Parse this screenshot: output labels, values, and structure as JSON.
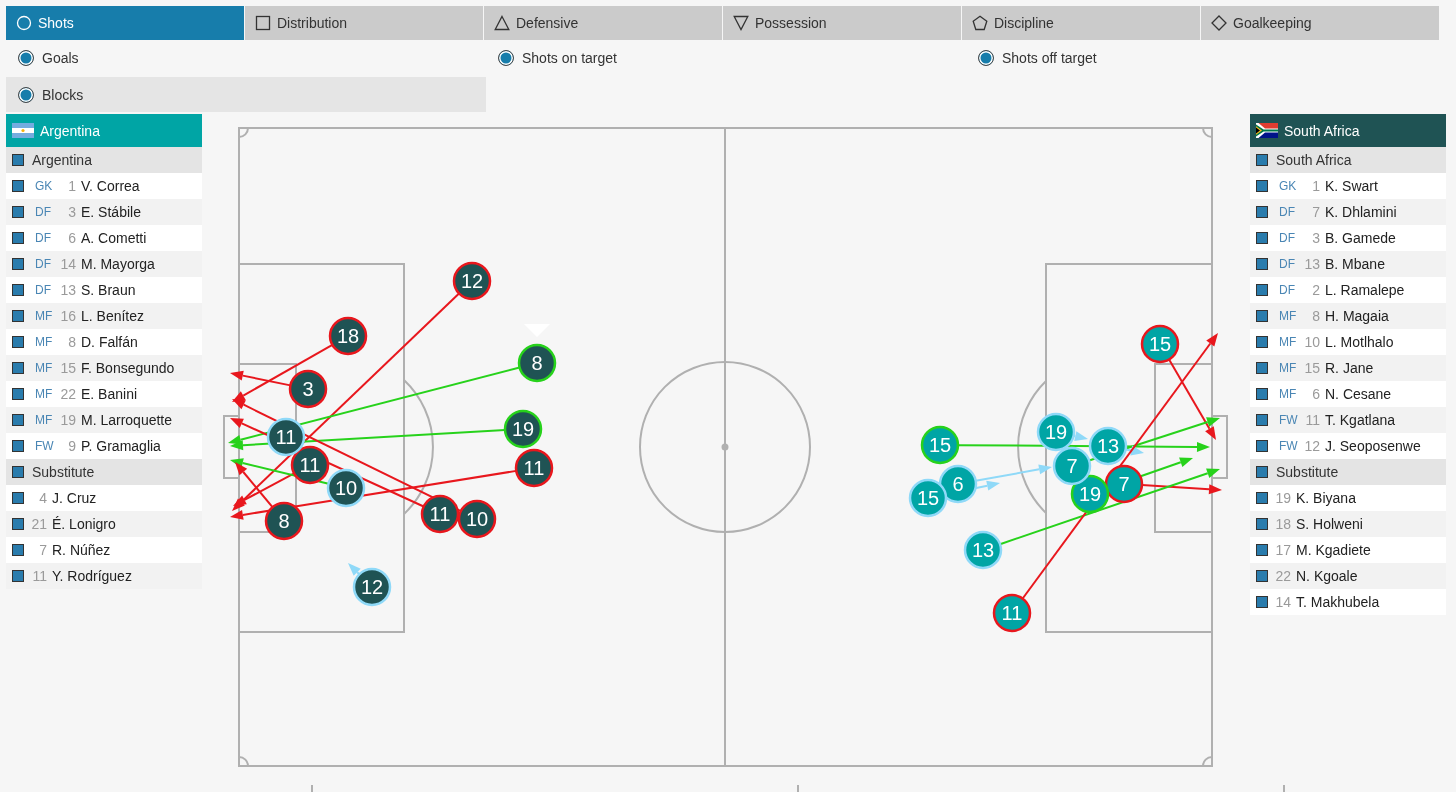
{
  "tabs": [
    {
      "label": "Shots",
      "selected": true
    },
    {
      "label": "Distribution",
      "selected": false
    },
    {
      "label": "Defensive",
      "selected": false
    },
    {
      "label": "Possession",
      "selected": false
    },
    {
      "label": "Discipline",
      "selected": false
    },
    {
      "label": "Goalkeeping",
      "selected": false
    }
  ],
  "filters": [
    {
      "label": "Goals",
      "checked": true,
      "highlighted": false
    },
    {
      "label": "Shots on target",
      "checked": true,
      "highlighted": false
    },
    {
      "label": "Shots off target",
      "checked": true,
      "highlighted": false
    },
    {
      "label": "Blocks",
      "checked": true,
      "highlighted": true
    }
  ],
  "left_panel": {
    "team": "Argentina",
    "color": "#00a5a5",
    "groups": [
      {
        "label": "Argentina",
        "checked": true,
        "players": [
          {
            "position": "GK",
            "number": "1",
            "name": "V. Correa",
            "checked": true
          },
          {
            "position": "DF",
            "number": "3",
            "name": "E. Stábile",
            "checked": true
          },
          {
            "position": "DF",
            "number": "6",
            "name": "A. Cometti",
            "checked": true
          },
          {
            "position": "DF",
            "number": "14",
            "name": "M. Mayorga",
            "checked": true
          },
          {
            "position": "DF",
            "number": "13",
            "name": "S. Braun",
            "checked": true
          },
          {
            "position": "MF",
            "number": "16",
            "name": "L. Benítez",
            "checked": true
          },
          {
            "position": "MF",
            "number": "8",
            "name": "D. Falfán",
            "checked": true
          },
          {
            "position": "MF",
            "number": "15",
            "name": "F. Bonsegundo",
            "checked": true
          },
          {
            "position": "MF",
            "number": "22",
            "name": "E. Banini",
            "checked": true
          },
          {
            "position": "MF",
            "number": "19",
            "name": "M. Larroquette",
            "checked": true
          },
          {
            "position": "FW",
            "number": "9",
            "name": "P. Gramaglia",
            "checked": true
          }
        ]
      },
      {
        "label": "Substitute",
        "checked": true,
        "players": [
          {
            "number": "4",
            "name": "J. Cruz",
            "checked": true
          },
          {
            "number": "21",
            "name": "É. Lonigro",
            "checked": true
          },
          {
            "number": "7",
            "name": "R. Núñez",
            "checked": true
          },
          {
            "number": "11",
            "name": "Y. Rodríguez",
            "checked": true
          }
        ]
      }
    ]
  },
  "pitch": {
    "left_goal_arrows": [
      {
        "kind": "off_target"
      },
      {
        "kind": "off_target"
      },
      {
        "kind": "off_target"
      },
      {
        "kind": "on_target"
      },
      {
        "kind": "on_target"
      },
      {
        "kind": "off_target"
      },
      {
        "kind": "on_target"
      },
      {
        "kind": "off_target"
      },
      {
        "kind": "off_target"
      },
      {
        "kind": "off_target"
      },
      {
        "kind": "off_target"
      },
      {
        "kind": "blocked"
      }
    ],
    "left_goal_shots": [
      {
        "number": "12",
        "kind": "off_target"
      },
      {
        "number": "18",
        "kind": "off_target"
      },
      {
        "number": "3",
        "kind": "off_target"
      },
      {
        "number": "8",
        "kind": "on_target"
      },
      {
        "number": "11",
        "kind": "blocked"
      },
      {
        "number": "19",
        "kind": "on_target"
      },
      {
        "number": "11",
        "kind": "off_target"
      },
      {
        "number": "10",
        "kind": "blocked"
      },
      {
        "number": "11",
        "kind": "off_target"
      },
      {
        "number": "8",
        "kind": "off_target"
      },
      {
        "number": "11",
        "kind": "off_target"
      },
      {
        "number": "10",
        "kind": "off_target"
      },
      {
        "number": "12",
        "kind": "blocked"
      }
    ],
    "right_goal_arrows": [
      {
        "kind": "off_target"
      },
      {
        "kind": "on_target"
      },
      {
        "kind": "blocked"
      },
      {
        "kind": "on_target"
      },
      {
        "kind": "blocked"
      },
      {
        "kind": "blocked"
      },
      {
        "kind": "blocked"
      },
      {
        "kind": "on_target"
      },
      {
        "kind": "off_target"
      },
      {
        "kind": "on_target"
      },
      {
        "kind": "off_target"
      }
    ],
    "right_goal_shots": [
      {
        "number": "15",
        "kind": "off_target"
      },
      {
        "number": "15",
        "kind": "on_target"
      },
      {
        "number": "19",
        "kind": "blocked"
      },
      {
        "number": "7",
        "kind": "blocked"
      },
      {
        "number": "13",
        "kind": "blocked"
      },
      {
        "number": "15",
        "kind": "blocked"
      },
      {
        "number": "6",
        "kind": "blocked"
      },
      {
        "number": "19",
        "kind": "on_target"
      },
      {
        "number": "7",
        "kind": "off_target"
      },
      {
        "number": "13",
        "kind": "blocked"
      },
      {
        "number": "11",
        "kind": "off_target"
      }
    ]
  },
  "right_panel": {
    "team": "South Africa",
    "color": "#1f5354",
    "groups": [
      {
        "label": "South Africa",
        "checked": true,
        "players": [
          {
            "position": "GK",
            "number": "1",
            "name": "K. Swart",
            "checked": true
          },
          {
            "position": "DF",
            "number": "7",
            "name": "K. Dhlamini",
            "checked": true
          },
          {
            "position": "DF",
            "number": "3",
            "name": "B. Gamede",
            "checked": true
          },
          {
            "position": "DF",
            "number": "13",
            "name": "B. Mbane",
            "checked": true
          },
          {
            "position": "DF",
            "number": "2",
            "name": "L. Ramalepe",
            "checked": true
          },
          {
            "position": "MF",
            "number": "8",
            "name": "H. Magaia",
            "checked": true
          },
          {
            "position": "MF",
            "number": "10",
            "name": "L. Motlhalo",
            "checked": true
          },
          {
            "position": "MF",
            "number": "15",
            "name": "R. Jane",
            "checked": true
          },
          {
            "position": "MF",
            "number": "6",
            "name": "N. Cesane",
            "checked": true
          },
          {
            "position": "FW",
            "number": "11",
            "name": "T. Kgatlana",
            "checked": true
          },
          {
            "position": "FW",
            "number": "12",
            "name": "J. Seoposenwe",
            "checked": true
          }
        ]
      },
      {
        "label": "Substitute",
        "checked": true,
        "players": [
          {
            "number": "19",
            "name": "K. Biyana",
            "checked": true
          },
          {
            "number": "18",
            "name": "S. Holweni",
            "checked": true
          },
          {
            "number": "17",
            "name": "M. Kgadiete",
            "checked": true
          },
          {
            "number": "22",
            "name": "N. Kgoale",
            "checked": true
          },
          {
            "number": "14",
            "name": "T. Makhubela",
            "checked": true
          }
        ]
      }
    ]
  }
}
